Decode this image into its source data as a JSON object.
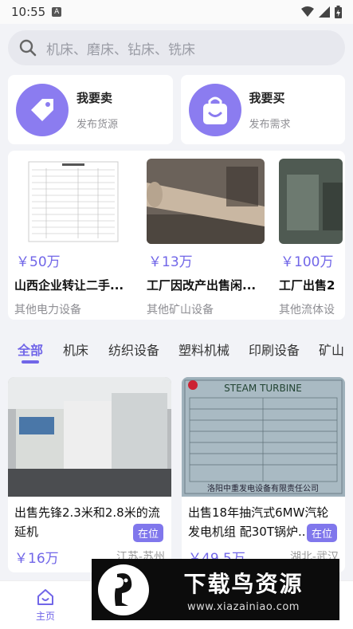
{
  "status_bar": {
    "time": "10:55",
    "notif_letter": "A"
  },
  "search": {
    "placeholder": "机床、磨床、钻床、铣床"
  },
  "actions": [
    {
      "title": "我要卖",
      "subtitle": "发布货源",
      "icon": "price-tag-icon"
    },
    {
      "title": "我要买",
      "subtitle": "发布需求",
      "icon": "shopping-bag-icon"
    }
  ],
  "featured": [
    {
      "price": "￥50万",
      "title": "山西企业转让二手...",
      "category": "其他电力设备"
    },
    {
      "price": "￥13万",
      "title": "工厂因改产出售闲...",
      "category": "其他矿山设备"
    },
    {
      "price": "￥100万",
      "title": "工厂出售2",
      "category": "其他流体设"
    }
  ],
  "categories": [
    "全部",
    "机床",
    "纺织设备",
    "塑料机械",
    "印刷设备",
    "矿山"
  ],
  "listings": [
    {
      "title": "出售先锋2.3米和2.8米的流延机",
      "badge": "在位",
      "price": "￥16万",
      "location": "江苏-苏州"
    },
    {
      "title": "出售18年抽汽式6MW汽轮发电机组 配30T锅炉...",
      "badge": "在位",
      "price": "￥49.5万",
      "location": "湖北-武汉"
    }
  ],
  "turbine_plate": {
    "line1": "STEAM TURBINE",
    "line2": "洛阳中重发电设备有限责任公司"
  },
  "nav": {
    "home_label": "主页"
  },
  "watermark": {
    "main": "下载鸟资源",
    "url": "www.xiazainiao.com"
  },
  "colors": {
    "accent": "#7166e8",
    "icon_bg": "#8b7cf0"
  }
}
